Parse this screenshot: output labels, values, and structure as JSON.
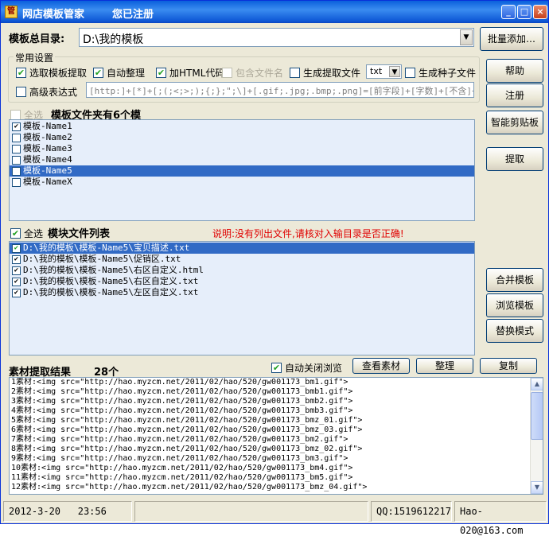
{
  "window": {
    "title": "网店模板管家",
    "reg_status": "您已注册",
    "app_icon": "管"
  },
  "title_buttons": {
    "minimize": "_",
    "maximize": "□",
    "close": "×"
  },
  "dir": {
    "label": "模板总目录:",
    "value": "D:\\我的模板"
  },
  "buttons": {
    "batch_add": "批量添加…",
    "help": "帮助",
    "register": "注册",
    "smart_clip": "智能剪贴板",
    "extract": "提取",
    "merge": "合并模板",
    "browse": "浏览模板",
    "replace": "替换模式",
    "view_material": "查看素材",
    "tidy": "整理",
    "copy": "复制"
  },
  "common": {
    "title": "常用设置",
    "opt_extract": "选取模板提取",
    "opt_auto": "自动整理",
    "opt_html": "加HTML代码",
    "opt_include": "包含文件名",
    "opt_gen_extract": "生成提取文件",
    "ext_value": "txt",
    "opt_seed": "生成种子文件",
    "opt_regex": "高级表达式",
    "regex_value": "[http:]+[*]+[;(;<;>;);{;};\";\\]+[.gif;.jpg;.bmp;.png]=[前字段]+[字数]+[不含]+[后字"
  },
  "templates": {
    "select_all": "全选",
    "header": "模板文件夹有6个模",
    "items": [
      "模板-Name1",
      "模板-Name2",
      "模板-Name3",
      "模板-Name4",
      "模板-Name5",
      "模板-NameX"
    ]
  },
  "modules": {
    "select_all": "全选",
    "header": "模块文件列表",
    "notice": "说明:没有列出文件,请核对入输目录是否正确!",
    "items": [
      "D:\\我的模板\\模板-Name5\\宝贝描述.txt",
      "D:\\我的模板\\模板-Name5\\促销区.txt",
      "D:\\我的模板\\模板-Name5\\右区自定义.html",
      "D:\\我的模板\\模板-Name5\\右区自定义.txt",
      "D:\\我的模板\\模板-Name5\\左区自定义.txt"
    ]
  },
  "results": {
    "title": "素材提取结果",
    "count": "28个",
    "auto_close": "自动关闭浏览",
    "lines": [
      "1素材:<img src=\"http://hao.myzcm.net/2011/02/hao/520/gw001173_bm1.gif\">",
      "2素材:<img src=\"http://hao.myzcm.net/2011/02/hao/520/gw001173_bmb1.gif\">",
      "3素材:<img src=\"http://hao.myzcm.net/2011/02/hao/520/gw001173_bmb2.gif\">",
      "4素材:<img src=\"http://hao.myzcm.net/2011/02/hao/520/gw001173_bmb3.gif\">",
      "5素材:<img src=\"http://hao.myzcm.net/2011/02/hao/520/gw001173_bmz_01.gif\">",
      "6素材:<img src=\"http://hao.myzcm.net/2011/02/hao/520/gw001173_bmz_03.gif\">",
      "7素材:<img src=\"http://hao.myzcm.net/2011/02/hao/520/gw001173_bm2.gif\">",
      "8素材:<img src=\"http://hao.myzcm.net/2011/02/hao/520/gw001173_bmz_02.gif\">",
      "9素材:<img src=\"http://hao.myzcm.net/2011/02/hao/520/gw001173_bm3.gif\">",
      "10素材:<img src=\"http://hao.myzcm.net/2011/02/hao/520/gw001173_bm4.gif\">",
      "11素材:<img src=\"http://hao.myzcm.net/2011/02/hao/520/gw001173_bm5.gif\">",
      "12素材:<img src=\"http://hao.myzcm.net/2011/02/hao/520/gw001173_bmz_04.gif\">"
    ]
  },
  "status": {
    "date": "2012-3-20",
    "time": "23:56",
    "qq": "QQ:1519612217",
    "email": "Hao-020@163.com"
  },
  "glyphs": {
    "check": "✔",
    "dropdown": "▼",
    "scroll_up": "▲",
    "scroll_down": "▼"
  }
}
